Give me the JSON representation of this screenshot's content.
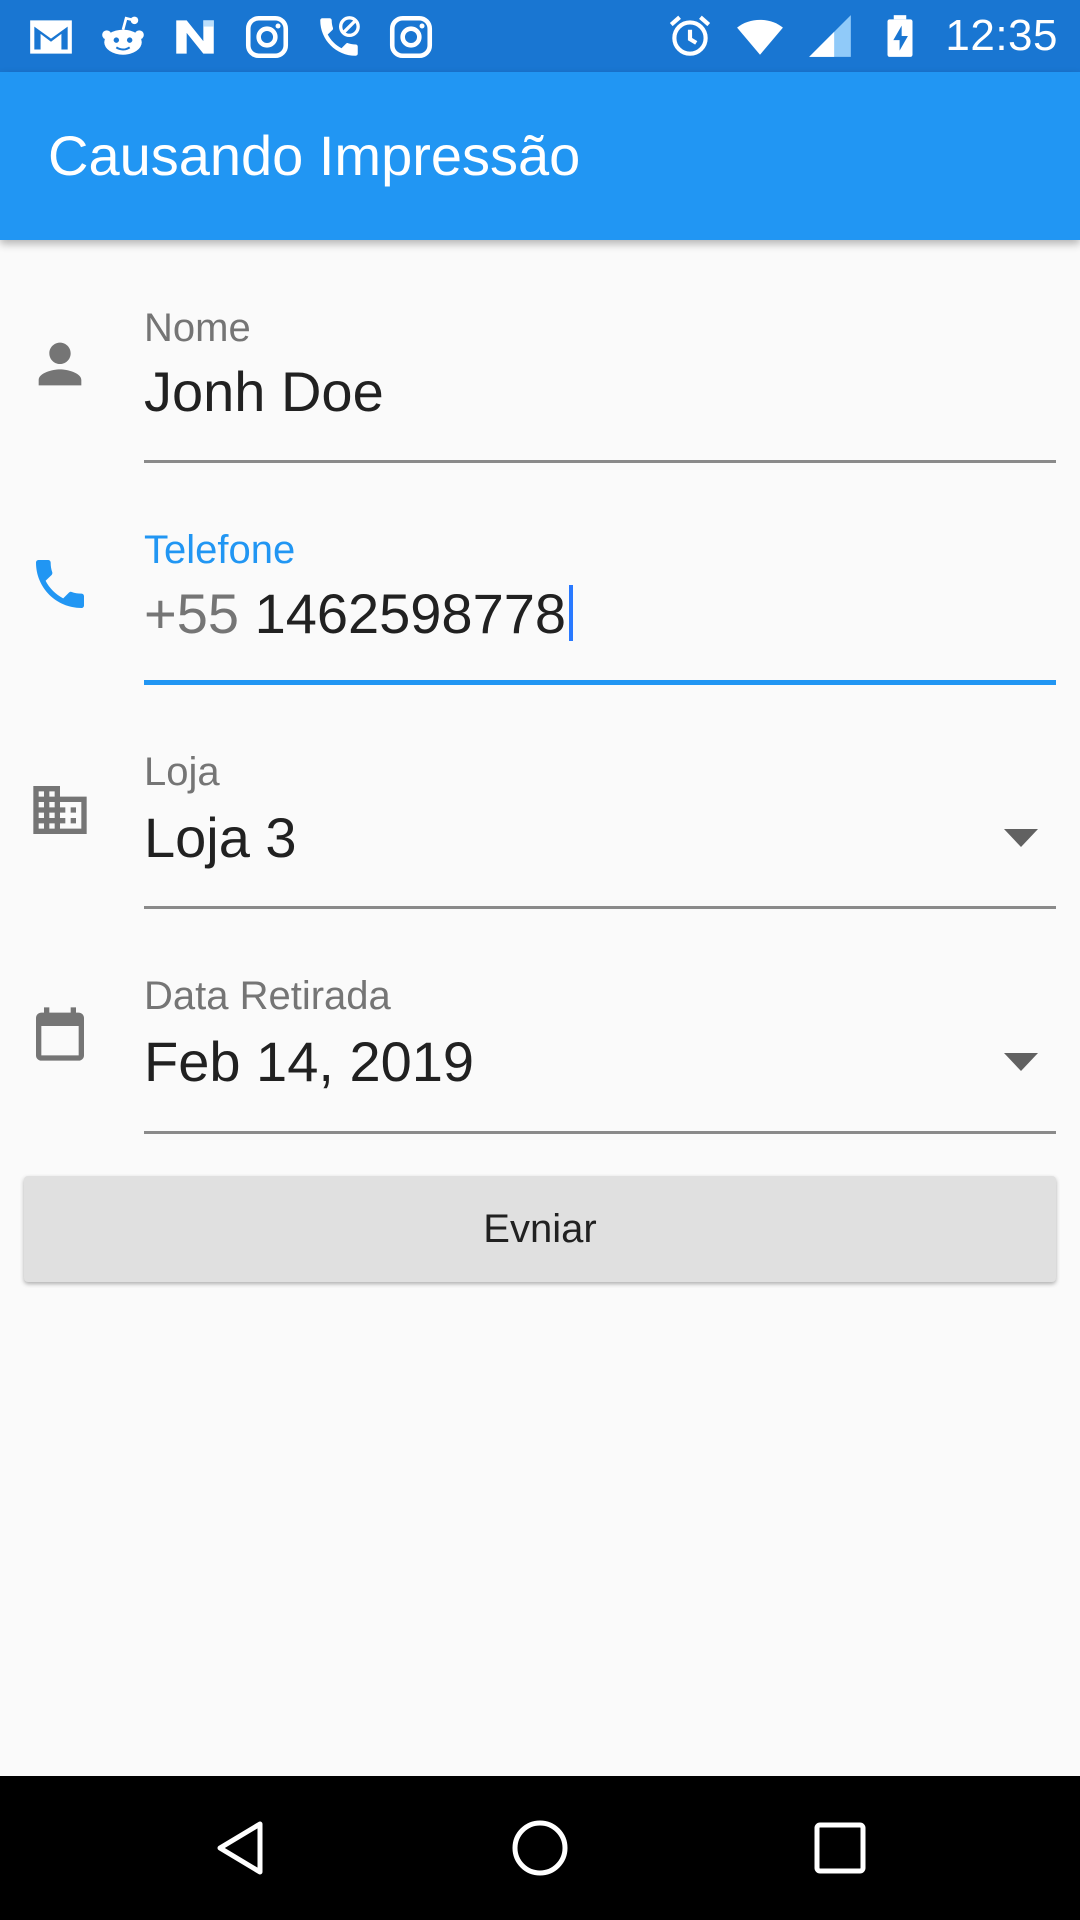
{
  "status_bar": {
    "time": "12:35",
    "notification_icons": [
      "gmail-icon",
      "reddit-icon",
      "news-icon",
      "instagram-icon",
      "missed-call-icon",
      "instagram-icon"
    ],
    "system_icons": [
      "alarm-icon",
      "wifi-icon",
      "signal-icon",
      "battery-charging-icon"
    ]
  },
  "app_bar": {
    "title": "Causando Impressão",
    "color": "#2196F3"
  },
  "form": {
    "name": {
      "label": "Nome",
      "value": "Jonh Doe",
      "icon": "person-icon"
    },
    "phone": {
      "label": "Telefone",
      "prefix": "+55",
      "value": "1462598778",
      "icon": "phone-icon",
      "focused": true
    },
    "store": {
      "label": "Loja",
      "value": "Loja 3",
      "icon": "business-icon"
    },
    "pickup_date": {
      "label": "Data Retirada",
      "value": "Feb 14, 2019",
      "icon": "calendar-icon"
    },
    "accent_color": "#2196F3"
  },
  "submit_button": {
    "label": "Evniar"
  },
  "nav_bar": {
    "buttons": [
      "back-icon",
      "home-icon",
      "recents-icon"
    ]
  }
}
